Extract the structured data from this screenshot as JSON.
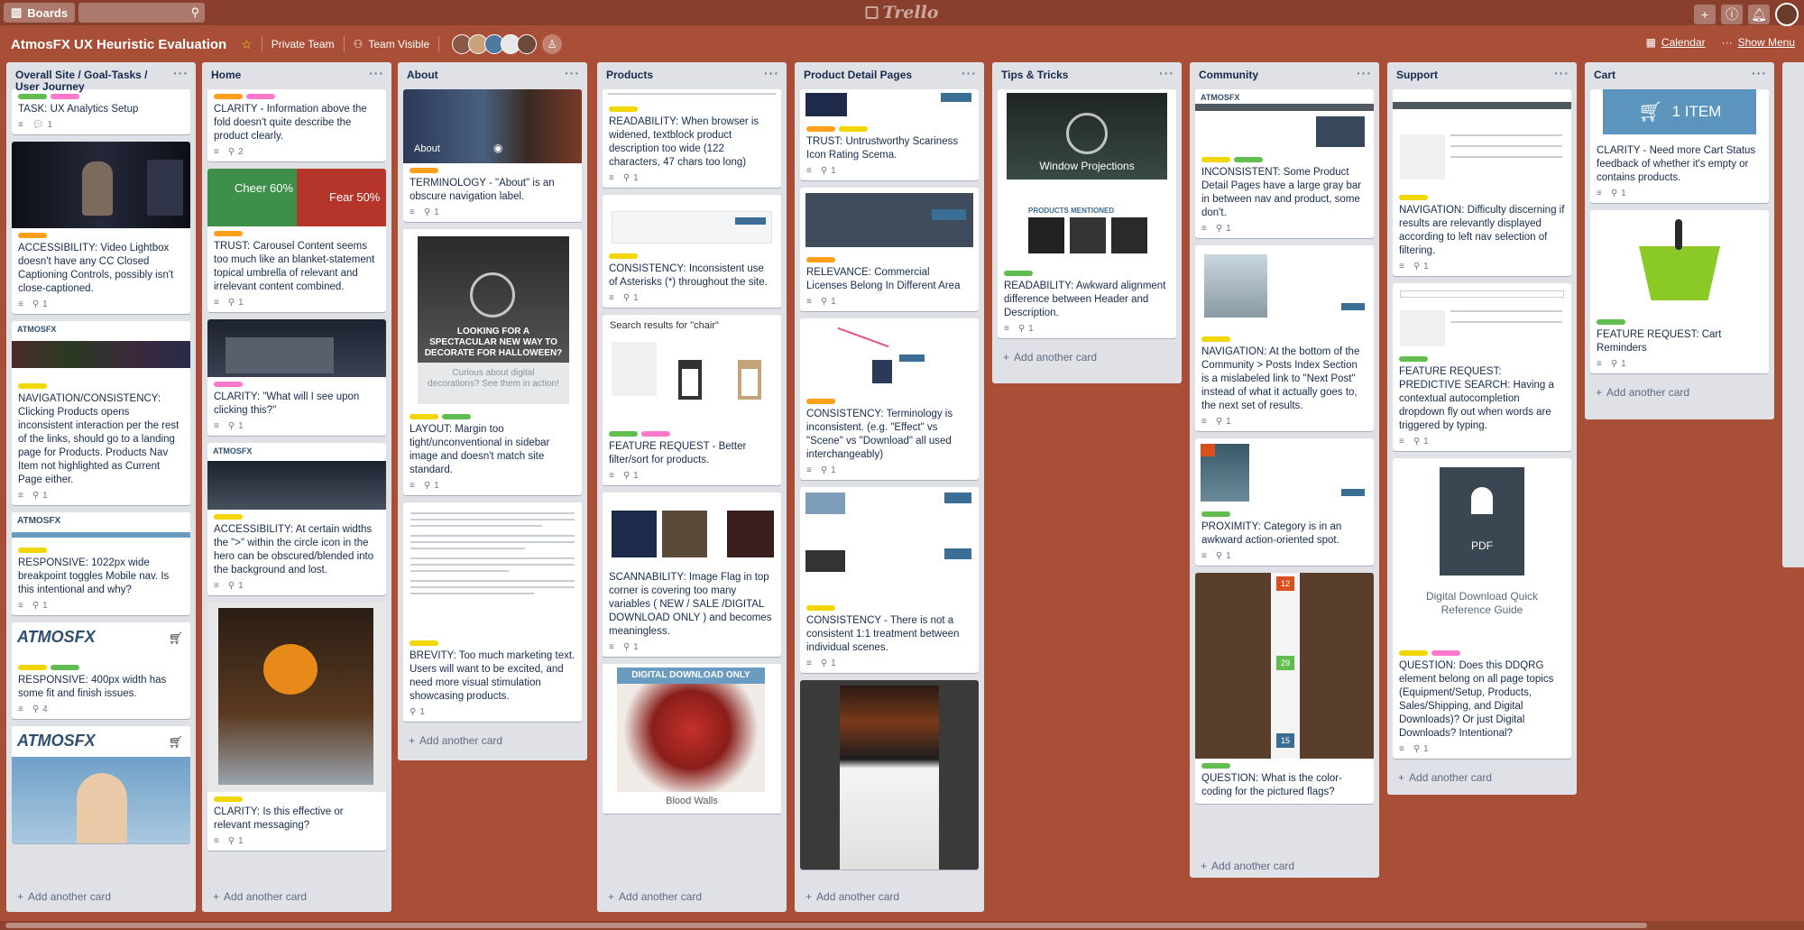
{
  "topbar": {
    "boards_label": "Boards",
    "logo_text": "Trello"
  },
  "board": {
    "title": "AtmosFX UX Heuristic Evaluation",
    "team": "Private Team",
    "visibility": "Team Visible",
    "calendar": "Calendar",
    "show_menu": "Show Menu"
  },
  "add_card_label": "Add another card",
  "colors": {
    "green": "#61bd4f",
    "yellow": "#f2d600",
    "orange": "#ff9f1a",
    "pink": "#ff78cb",
    "background": "#a94e37"
  },
  "lists": [
    {
      "title": "Overall Site / Goal-Tasks / User Journey",
      "cards": [
        {
          "title": "TASK: UX Analytics Setup",
          "comments": "1"
        },
        {
          "title": "ACCESSIBILITY: Video Lightbox doesn't have any CC Closed Captioning Controls, possibly isn't close-captioned.",
          "attachments": "1"
        },
        {
          "title": "NAVIGATION/CONSISTENCY: Clicking Products opens inconsistent interaction per the rest of the links, should go to a landing page for Products. Products Nav Item not highlighted as Current Page either.",
          "attachments": "1"
        },
        {
          "title": "RESPONSIVE: 1022px wide breakpoint toggles Mobile nav. Is this intentional and why?",
          "attachments": "1"
        },
        {
          "title": "RESPONSIVE: 400px width has some fit and finish issues.",
          "attachments": "4"
        },
        {
          "title": "",
          "image_text": "ATMOSFX"
        }
      ]
    },
    {
      "title": "Home",
      "cards": [
        {
          "title": "CLARITY - Information above the fold doesn't quite describe the product clearly.",
          "attachments": "2"
        },
        {
          "title": "TRUST: Carousel Content seems too much like an blanket-statement topical umbrella of relevant and irrelevant content combined.",
          "attachments": "1",
          "image_text_1": "Cheer 60%",
          "image_text_2": "Fear 50%"
        },
        {
          "title": "CLARITY: \"What will I see upon clicking this?\"",
          "attachments": "1"
        },
        {
          "title": "ACCESSIBILITY: At certain widths the \">\" within the circle icon in the hero can be obscured/blended into the background and lost.",
          "attachments": "1"
        },
        {
          "title": "CLARITY: Is this effective or relevant messaging?",
          "attachments": "1"
        }
      ]
    },
    {
      "title": "About",
      "cards": [
        {
          "title": "TERMINOLOGY - \"About\" is an obscure navigation label.",
          "attachments": "1",
          "image_text": "About"
        },
        {
          "title": "LAYOUT: Margin too tight/unconventional in sidebar image and doesn't match site standard.",
          "attachments": "1",
          "image_text": "LOOKING FOR A SPECTACULAR NEW WAY TO DECORATE FOR HALLOWEEN?",
          "image_sub": "Curious about digital decorations? See them in action!"
        },
        {
          "title": "BREVITY: Too much marketing text. Users will want to be excited, and need more visual stimulation showcasing products.",
          "attachments": "1"
        }
      ]
    },
    {
      "title": "Products",
      "cards": [
        {
          "title": "READABILITY: When browser is widened, textblock product description too wide (122 characters, 47 chars too long)",
          "attachments": "1"
        },
        {
          "title": "CONSISTENCY: Inconsistent use of Asterisks (*) throughout the site.",
          "attachments": "1"
        },
        {
          "title": "FEATURE REQUEST - Better filter/sort for products.",
          "attachments": "1",
          "image_text": "Search results for \"chair\""
        },
        {
          "title": "SCANNABILITY: Image Flag in top corner is covering too many variables ( NEW / SALE /DIGITAL DOWNLOAD ONLY ) and becomes meaningless.",
          "attachments": "1"
        },
        {
          "title": "",
          "image_text": "DIGITAL DOWNLOAD ONLY",
          "image_caption": "Blood Walls"
        }
      ]
    },
    {
      "title": "Product Detail Pages",
      "cards": [
        {
          "title": "TRUST: Untrustworthy Scariness Icon Rating Scema.",
          "attachments": "1"
        },
        {
          "title": "RELEVANCE: Commercial Licenses Belong In Different Area",
          "attachments": "1"
        },
        {
          "title": "CONSISTENCY: Terminology is inconsistent. (e.g. \"Effect\" vs \"Scene\" vs \"Download\" all used interchangeably)",
          "attachments": "1"
        },
        {
          "title": "CONSISTENCY - There is not a consistent 1:1 treatment between individual scenes.",
          "attachments": "1"
        },
        {
          "title": ""
        }
      ]
    },
    {
      "title": "Tips & Tricks",
      "cards": [
        {
          "title": "READABILITY: Awkward alignment difference between Header and Description.",
          "attachments": "1",
          "image_text": "Window Projections",
          "image_sub": "PRODUCTS MENTIONED"
        }
      ]
    },
    {
      "title": "Community",
      "cards": [
        {
          "title": "INCONSISTENT: Some Product Detail Pages have a large gray bar in between nav and product, some don't.",
          "attachments": "1"
        },
        {
          "title": "NAVIGATION: At the bottom of the Community > Posts Index Section is a mislabeled link to \"Next Post\" instead of what it actually goes to, the next set of results.",
          "attachments": "1"
        },
        {
          "title": "PROXIMITY: Category is in an awkward action-oriented spot.",
          "attachments": "1"
        },
        {
          "title": "QUESTION: What is the color-coding for the pictured flags?",
          "flag_1": "12",
          "flag_2": "29",
          "flag_3": "15"
        }
      ]
    },
    {
      "title": "Support",
      "cards": [
        {
          "title": "NAVIGATION: Difficulty discerning if results are relevantly displayed according to left nav selection of filtering.",
          "attachments": "1"
        },
        {
          "title": "FEATURE REQUEST: PREDICTIVE SEARCH: Having a contextual autocompletion dropdown fly out when words are triggered by typing.",
          "attachments": "1"
        },
        {
          "title": "QUESTION: Does this DDQRG element belong on all page topics (Equipment/Setup, Products, Sales/Shipping, and Digital Downloads)? Or just Digital Downloads? Intentional?",
          "attachments": "1",
          "image_text": "PDF",
          "image_caption": "Digital Download Quick Reference Guide"
        }
      ]
    },
    {
      "title": "Cart",
      "cards": [
        {
          "title": "CLARITY - Need more Cart Status feedback of whether it's empty or contains products.",
          "attachments": "1",
          "image_text": "1 ITEM"
        },
        {
          "title": "FEATURE REQUEST: Cart Reminders",
          "attachments": "1"
        }
      ]
    }
  ]
}
